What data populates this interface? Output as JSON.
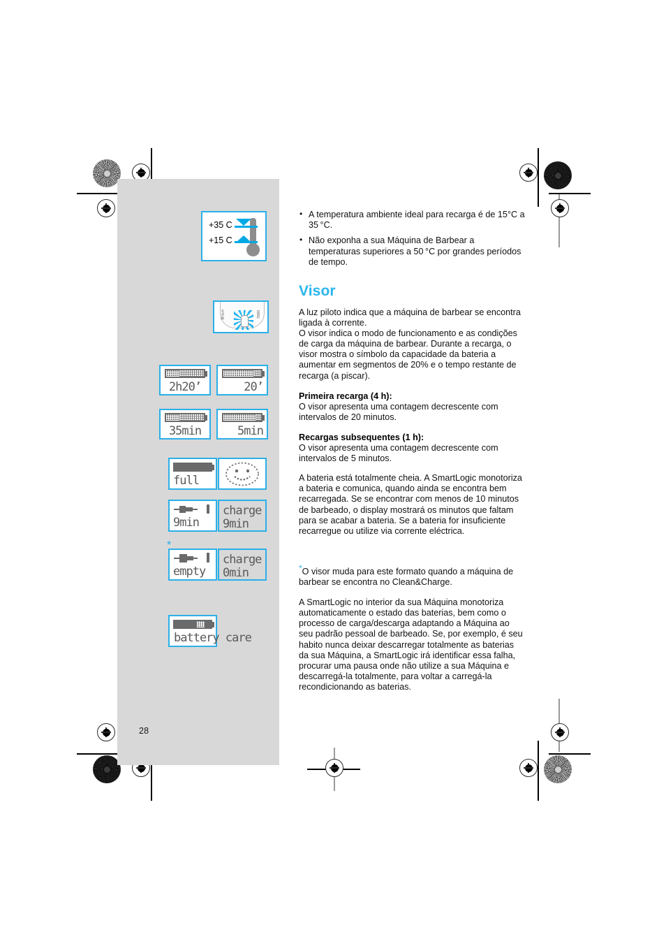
{
  "page": {
    "number": "28",
    "accent_color": "#29b6ea",
    "panel_color": "#d8d8d8"
  },
  "figures": {
    "thermometer": {
      "name": "temperature-range-diagram",
      "upper_label": "+35 C",
      "lower_label": "+15 C"
    },
    "shaver": {
      "name": "shaver-pilot-light-diagram",
      "brand_left": "Braun",
      "brand_right": "7680"
    },
    "footnote_marker": "*",
    "lcd_displays": [
      {
        "name": "lcd-2h20",
        "battery": "partial-dither",
        "label": "2h20’",
        "shaded": false
      },
      {
        "name": "lcd-20min",
        "battery": "near-full-dither",
        "label": "20’",
        "shaded": false
      },
      {
        "name": "lcd-35min",
        "battery": "partial-dither",
        "label": "35min",
        "shaded": false
      },
      {
        "name": "lcd-5min",
        "battery": "near-full-dither",
        "label": "5min",
        "shaded": false
      },
      {
        "name": "lcd-full",
        "battery": "full",
        "label": "full",
        "shaded": false
      },
      {
        "name": "lcd-smiley",
        "battery": "smiley",
        "label": "",
        "shaded": false
      },
      {
        "name": "lcd-plug-9min",
        "battery": "plug",
        "label": "9min",
        "shaded": false
      },
      {
        "name": "lcd-charge-9min",
        "battery": "text-charge",
        "label": "9min",
        "top_text": "charge",
        "shaded": true
      },
      {
        "name": "lcd-plug-empty",
        "battery": "plug",
        "label": "empty",
        "shaded": false
      },
      {
        "name": "lcd-charge-0min",
        "battery": "text-charge",
        "label": "0min",
        "top_text": "charge",
        "shaded": true
      },
      {
        "name": "lcd-battery-care",
        "battery": "care",
        "label": "battery care",
        "shaded": false
      }
    ]
  },
  "content": {
    "bullets": [
      "A temperatura ambiente ideal para recarga é de 15°C a 35 °C.",
      "Não exponha a sua Máquina de Barbear a temperaturas superiores a 50 °C por grandes períodos de tempo."
    ],
    "section_title": "Visor",
    "paragraph_1": "A luz piloto indica que a máquina de barbear se encontra ligada à corrente.\nO visor indica o modo de funcionamento e as condições de carga da máquina de barbear. Durante a recarga, o visor mostra o símbolo da capacidade da bateria a aumentar em segmentos de 20% e o tempo restante de recarga (a piscar).",
    "subhead_1": "Primeira recarga (4 h):",
    "paragraph_2": "O visor apresenta uma contagem decrescente com intervalos de 20 minutos.",
    "subhead_2": "Recargas subsequentes (1 h):",
    "paragraph_3": "O visor apresenta uma contagem decrescente com intervalos de 5 minutos.",
    "paragraph_4": "A bateria está totalmente cheia. A SmartLogic monotoriza a bateria e comunica, quando ainda se encontra bem recarregada. Se se encontrar com menos de 10 minutos de barbeado, o display mostrará os minutos que faltam para se acabar a bateria. Se a bateria for insuficiente recarregue ou utilize via corrente eléctrica.",
    "footnote_marker": "*",
    "paragraph_5": "O visor muda para este formato quando a máquina de barbear se encontra no Clean&Charge.",
    "paragraph_6": "A SmartLogic no interior da sua Máquina monotoriza automaticamente o estado das baterias, bem como o processo de carga/descarga adaptando a Máquina ao seu padrão pessoal de barbeado. Se, por exemplo, é seu habito nunca deixar descarregar totalmente as baterias da sua Máquina, a SmartLogic irá identificar essa falha, procurar uma pausa onde não utilize a sua Máquina e descarregá-la totalmente, para voltar a carregá-la recondicionando as baterias."
  }
}
